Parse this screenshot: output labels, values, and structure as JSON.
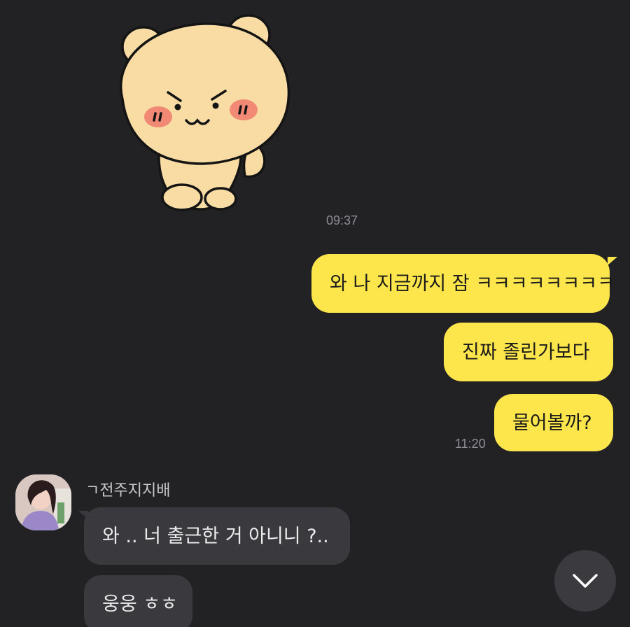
{
  "sticker": {
    "icon": "bear-sticker-icon"
  },
  "times": {
    "t1": "09:37",
    "t2": "11:20"
  },
  "outgoing": [
    {
      "text": "와 나 지금까지 잠 ㅋㅋㅋㅋㅋㅋㅋㅋ"
    },
    {
      "text": "진짜 졸린가보다"
    },
    {
      "text": "물어볼까?"
    }
  ],
  "incoming": {
    "sender": "ㄱ전주지지배",
    "messages": [
      {
        "text": "와 .. 너 출근한 거 아니니 ?.."
      },
      {
        "text": "웅웅 ㅎㅎ"
      }
    ]
  },
  "colors": {
    "background": "#222225",
    "outgoing_bubble": "#fde64b",
    "incoming_bubble": "#3a3a3e",
    "timestamp": "#8e8e93"
  },
  "scroll_button": {
    "icon": "chevron-down-icon"
  }
}
